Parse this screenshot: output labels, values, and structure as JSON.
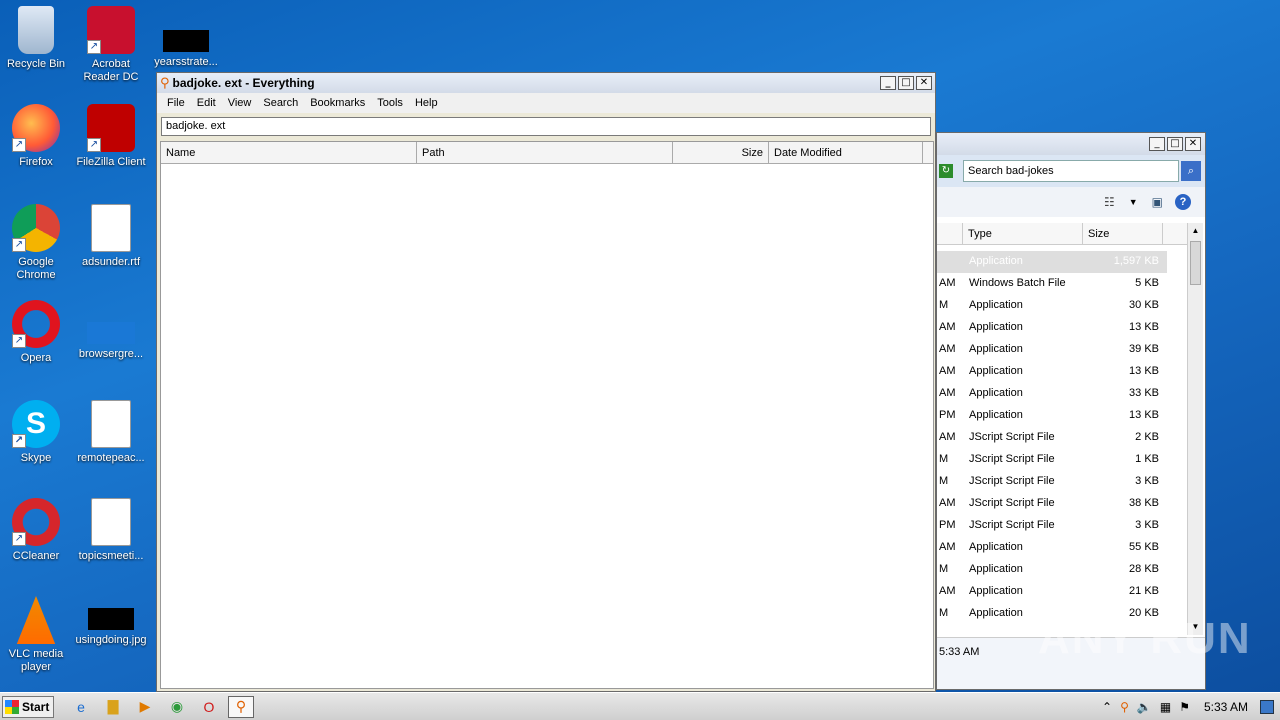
{
  "desktop": {
    "icons": [
      {
        "label": "Recycle Bin"
      },
      {
        "label": "Acrobat Reader DC"
      },
      {
        "label": "yearsstrate..."
      },
      {
        "label": "Firefox"
      },
      {
        "label": "FileZilla Client"
      },
      {
        "label": "Google Chrome"
      },
      {
        "label": "adsunder.rtf"
      },
      {
        "label": "Opera"
      },
      {
        "label": "browsergre..."
      },
      {
        "label": "Skype"
      },
      {
        "label": "remotepeac..."
      },
      {
        "label": "CCleaner"
      },
      {
        "label": "topicsmeeti..."
      },
      {
        "label": "VLC media player"
      },
      {
        "label": "usingdoing.jpg"
      }
    ]
  },
  "everything": {
    "title": "badjoke. ext - Everything",
    "menu": [
      "File",
      "Edit",
      "View",
      "Search",
      "Bookmarks",
      "Tools",
      "Help"
    ],
    "search_value": "badjoke. ext",
    "columns": [
      "Name",
      "Path",
      "Size",
      "Date Modified"
    ]
  },
  "explorer": {
    "search_placeholder": "Search bad-jokes",
    "columns": [
      "Type",
      "Size"
    ],
    "rows": [
      {
        "date": "",
        "type": "Application",
        "size": "1,597 KB"
      },
      {
        "date": "AM",
        "type": "Windows Batch File",
        "size": "5 KB"
      },
      {
        "date": "M",
        "type": "Application",
        "size": "30 KB"
      },
      {
        "date": "AM",
        "type": "Application",
        "size": "13 KB"
      },
      {
        "date": "AM",
        "type": "Application",
        "size": "39 KB"
      },
      {
        "date": "AM",
        "type": "Application",
        "size": "13 KB"
      },
      {
        "date": "AM",
        "type": "Application",
        "size": "33 KB"
      },
      {
        "date": "PM",
        "type": "Application",
        "size": "13 KB"
      },
      {
        "date": "AM",
        "type": "JScript Script File",
        "size": "2 KB"
      },
      {
        "date": "M",
        "type": "JScript Script File",
        "size": "1 KB"
      },
      {
        "date": "M",
        "type": "JScript Script File",
        "size": "3 KB"
      },
      {
        "date": "AM",
        "type": "JScript Script File",
        "size": "38 KB"
      },
      {
        "date": "PM",
        "type": "JScript Script File",
        "size": "3 KB"
      },
      {
        "date": "AM",
        "type": "Application",
        "size": "55 KB"
      },
      {
        "date": "M",
        "type": "Application",
        "size": "28 KB"
      },
      {
        "date": "AM",
        "type": "Application",
        "size": "21 KB"
      },
      {
        "date": "M",
        "type": "Application",
        "size": "20 KB"
      }
    ],
    "status_time": "5:33 AM"
  },
  "taskbar": {
    "start_label": "Start",
    "clock": "5:33 AM"
  },
  "watermark": "ANY RUN"
}
